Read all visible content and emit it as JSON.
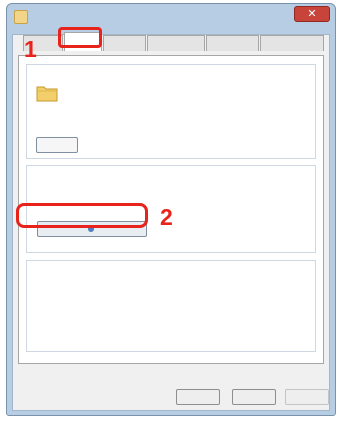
{
  "window": {
    "title": "",
    "close_glyph": "✕"
  },
  "tabs": [
    {
      "label": "",
      "active": true
    },
    {
      "label": "",
      "active": false
    },
    {
      "label": "",
      "active": false
    },
    {
      "label": "",
      "active": false
    },
    {
      "label": "",
      "active": false
    }
  ],
  "network_group": {
    "title": "",
    "folder_name": "",
    "folder_state": "",
    "path_label": "",
    "path_value": "",
    "share_button": ""
  },
  "advanced_group": {
    "title": "",
    "description": [
      "",
      ""
    ],
    "button": ""
  },
  "password_group": {
    "title": "",
    "description": [
      "",
      "",
      ""
    ],
    "link_prefix": "",
    "link_text": "",
    "link_suffix": ""
  },
  "footer": {
    "ok": "",
    "cancel": "",
    "apply": ""
  },
  "callouts": {
    "first": "1",
    "second": "2"
  },
  "colors": {
    "highlight": "#e8231b",
    "link": "#1f5cc4"
  }
}
